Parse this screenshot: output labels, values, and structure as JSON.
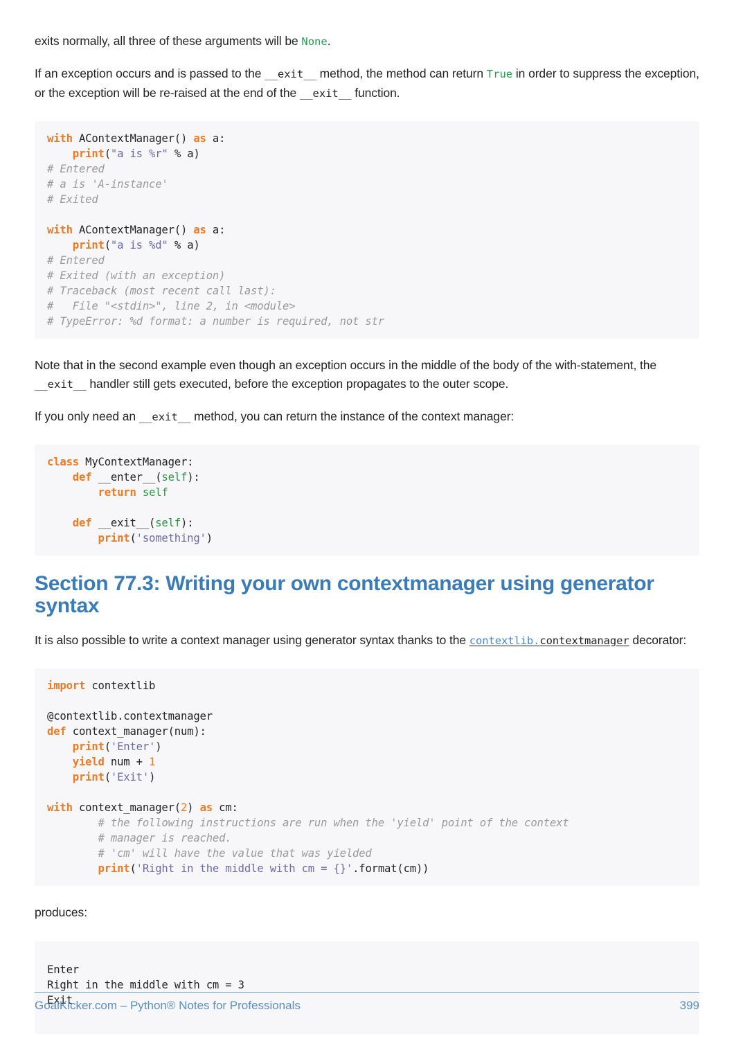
{
  "document": {
    "title": "Python Notes for Professionals - Section 77.3",
    "page_number": "399"
  },
  "paragraphs": {
    "p1_pre": "exits normally, all three of these arguments will be ",
    "p1_code_none": "None",
    "p1_post": ".",
    "p2_a": "If an exception occurs and is passed to the ",
    "p2_code_exit1": "__exit__",
    "p2_b": " method, the method can return ",
    "p2_code_true": "True",
    "p2_c": " in order to suppress the exception, or the exception will be re-raised at the end of the ",
    "p2_code_exit2": "__exit__",
    "p2_d": " function.",
    "p3_a": "Note that in the second example even though an exception occurs in the middle of the body of the with-statement, the ",
    "p3_code_exit": "__exit__",
    "p3_b": " handler still gets executed, before the exception propagates to the outer scope.",
    "p4_a": "If you only need an ",
    "p4_code_exit": "__exit__",
    "p4_b": " method, you can return the instance of the context manager:",
    "p5_a": "It is also possible to write a context manager using generator syntax thanks to the ",
    "p5_link_blue": "contextlib.",
    "p5_link_plain": "contextmanager",
    "p5_b": " decorator:",
    "p6": "produces:"
  },
  "heading": {
    "text": "Section 77.3: Writing your own contextmanager using generator syntax"
  },
  "code_blocks": {
    "block1": [
      {
        "t": "kw",
        "v": "with"
      },
      {
        "t": "pln",
        "v": " AContextManager() "
      },
      {
        "t": "kw",
        "v": "as"
      },
      {
        "t": "pln",
        "v": " a:\n    "
      },
      {
        "t": "fn",
        "v": "print"
      },
      {
        "t": "pln",
        "v": "("
      },
      {
        "t": "str",
        "v": "\"a is %r\""
      },
      {
        "t": "pln",
        "v": " % a)\n"
      },
      {
        "t": "com",
        "v": "# Entered\n# a is 'A-instance'\n# Exited"
      },
      {
        "t": "pln",
        "v": "\n\n"
      },
      {
        "t": "kw",
        "v": "with"
      },
      {
        "t": "pln",
        "v": " AContextManager() "
      },
      {
        "t": "kw",
        "v": "as"
      },
      {
        "t": "pln",
        "v": " a:\n    "
      },
      {
        "t": "fn",
        "v": "print"
      },
      {
        "t": "pln",
        "v": "("
      },
      {
        "t": "str",
        "v": "\"a is %d\""
      },
      {
        "t": "pln",
        "v": " % a)\n"
      },
      {
        "t": "com",
        "v": "# Entered\n# Exited (with an exception)\n# Traceback (most recent call last):\n#   File \"<stdin>\", line 2, in <module>\n# TypeError: %d format: a number is required, not str"
      }
    ],
    "block1_plain": "with AContextManager() as a:\n    print(\"a is %r\" % a)\n# Entered\n# a is 'A-instance'\n# Exited\n\nwith AContextManager() as a:\n    print(\"a is %d\" % a)\n# Entered\n# Exited (with an exception)\n# Traceback (most recent call last):\n#   File \"<stdin>\", line 2, in <module>\n# TypeError: %d format: a number is required, not str",
    "block2": [
      {
        "t": "kw",
        "v": "class"
      },
      {
        "t": "pln",
        "v": " MyContextManager:\n    "
      },
      {
        "t": "kw",
        "v": "def"
      },
      {
        "t": "pln",
        "v": " __enter__("
      },
      {
        "t": "self",
        "v": "self"
      },
      {
        "t": "pln",
        "v": "):\n        "
      },
      {
        "t": "kw",
        "v": "return"
      },
      {
        "t": "self",
        "v": " self"
      },
      {
        "t": "pln",
        "v": "\n\n    "
      },
      {
        "t": "kw",
        "v": "def"
      },
      {
        "t": "pln",
        "v": " __exit__("
      },
      {
        "t": "self",
        "v": "self"
      },
      {
        "t": "pln",
        "v": "):\n        "
      },
      {
        "t": "fn",
        "v": "print"
      },
      {
        "t": "pln",
        "v": "("
      },
      {
        "t": "str",
        "v": "'something'"
      },
      {
        "t": "pln",
        "v": ")"
      }
    ],
    "block2_plain": "class MyContextManager:\n    def __enter__(self):\n        return self\n\n    def __exit__(self):\n        print('something')",
    "block3": [
      {
        "t": "kw",
        "v": "import"
      },
      {
        "t": "pln",
        "v": " contextlib\n\n@contextlib.contextmanager\n"
      },
      {
        "t": "kw",
        "v": "def"
      },
      {
        "t": "pln",
        "v": " context_manager(num):\n    "
      },
      {
        "t": "fn",
        "v": "print"
      },
      {
        "t": "pln",
        "v": "("
      },
      {
        "t": "str",
        "v": "'Enter'"
      },
      {
        "t": "pln",
        "v": ")\n    "
      },
      {
        "t": "kw",
        "v": "yield"
      },
      {
        "t": "pln",
        "v": " num + "
      },
      {
        "t": "num",
        "v": "1"
      },
      {
        "t": "pln",
        "v": "\n    "
      },
      {
        "t": "fn",
        "v": "print"
      },
      {
        "t": "pln",
        "v": "("
      },
      {
        "t": "str",
        "v": "'Exit'"
      },
      {
        "t": "pln",
        "v": ")\n\n"
      },
      {
        "t": "kw",
        "v": "with"
      },
      {
        "t": "pln",
        "v": " context_manager("
      },
      {
        "t": "num",
        "v": "2"
      },
      {
        "t": "pln",
        "v": ") "
      },
      {
        "t": "kw",
        "v": "as"
      },
      {
        "t": "pln",
        "v": " cm:\n        "
      },
      {
        "t": "com",
        "v": "# the following instructions are run when the 'yield' point of the context\n        # manager is reached.\n        # 'cm' will have the value that was yielded"
      },
      {
        "t": "pln",
        "v": "\n        "
      },
      {
        "t": "fn",
        "v": "print"
      },
      {
        "t": "pln",
        "v": "("
      },
      {
        "t": "str",
        "v": "'Right in the middle with cm = {}'"
      },
      {
        "t": "pln",
        "v": ".format(cm))"
      }
    ],
    "block3_plain": "import contextlib\n\n@contextlib.contextmanager\ndef context_manager(num):\n    print('Enter')\n    yield num + 1\n    print('Exit')\n\nwith context_manager(2) as cm:\n        # the following instructions are run when the 'yield' point of the context\n        # manager is reached.\n        # 'cm' will have the value that was yielded\n        print('Right in the middle with cm = {}'.format(cm))",
    "block4_plain": "Enter\nRight in the middle with cm = 3\nExit"
  },
  "footer": {
    "label": "GoalKicker.com – Python® Notes for Professionals",
    "page": "399"
  }
}
